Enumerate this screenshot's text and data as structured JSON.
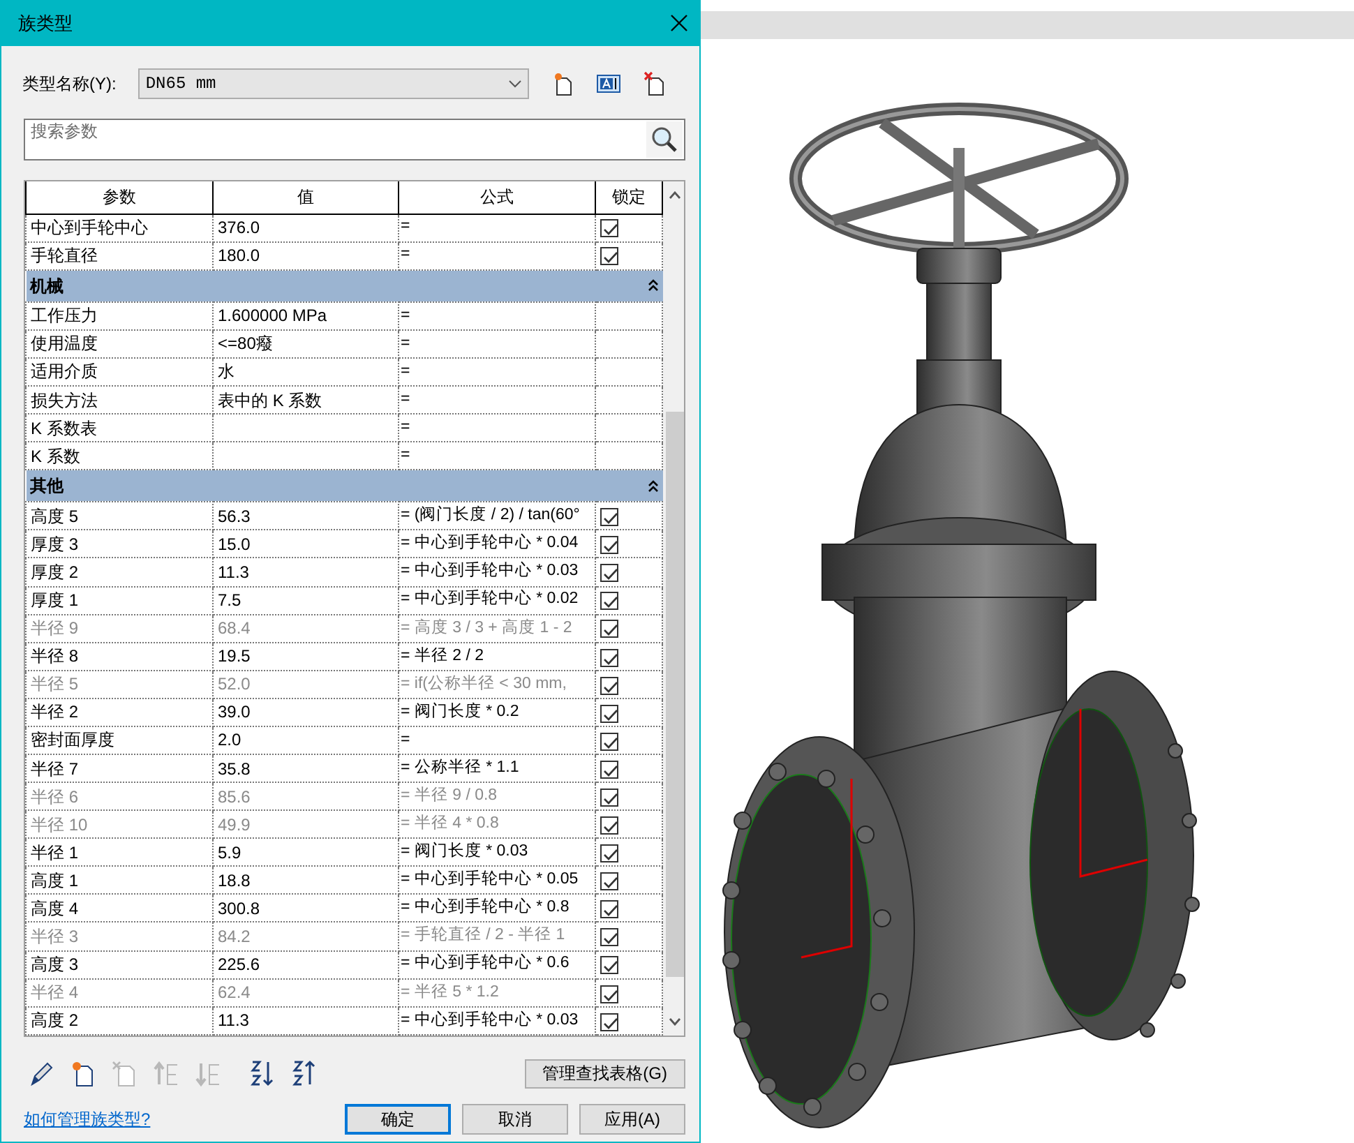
{
  "window": {
    "title": "族类型"
  },
  "type_name": {
    "label": "类型名称(Y):",
    "value": "DN65 mm"
  },
  "search": {
    "placeholder": "搜索参数"
  },
  "table": {
    "columns": [
      "参数",
      "值",
      "公式",
      "锁定"
    ],
    "sections": [
      {
        "rows": [
          {
            "name": "中心到手轮中心",
            "value": "376.0",
            "formula": "=",
            "locked": true,
            "disabled": false
          },
          {
            "name": "手轮直径",
            "value": "180.0",
            "formula": "=",
            "locked": true,
            "disabled": false
          }
        ]
      },
      {
        "title": "机械",
        "expanded": true,
        "rows": [
          {
            "name": "工作压力",
            "value": "1.600000 MPa",
            "formula": "=",
            "disabled": false
          },
          {
            "name": "使用温度",
            "value": "<=80癈",
            "formula": "=",
            "disabled": false
          },
          {
            "name": "适用介质",
            "value": "水",
            "formula": "=",
            "disabled": false
          },
          {
            "name": "损失方法",
            "value": "表中的 K 系数",
            "formula": "=",
            "disabled": false
          },
          {
            "name": "K 系数表",
            "value": "",
            "formula": "=",
            "disabled": false
          },
          {
            "name": "K 系数",
            "value": "",
            "formula": "=",
            "disabled": false
          }
        ]
      },
      {
        "title": "其他",
        "expanded": true,
        "rows": [
          {
            "name": "高度 5",
            "value": "56.3",
            "formula": "= (阀门长度 / 2) / tan(60°",
            "locked": true,
            "disabled": false
          },
          {
            "name": "厚度 3",
            "value": "15.0",
            "formula": "= 中心到手轮中心 * 0.04",
            "locked": true,
            "disabled": false
          },
          {
            "name": "厚度 2",
            "value": "11.3",
            "formula": "= 中心到手轮中心 * 0.03",
            "locked": true,
            "disabled": false
          },
          {
            "name": "厚度 1",
            "value": "7.5",
            "formula": "= 中心到手轮中心 * 0.02",
            "locked": true,
            "disabled": false
          },
          {
            "name": "半径 9",
            "value": "68.4",
            "formula": "= 高度 3 / 3 + 高度 1 - 2",
            "locked": true,
            "disabled": true
          },
          {
            "name": "半径 8",
            "value": "19.5",
            "formula": "= 半径 2 / 2",
            "locked": true,
            "disabled": false
          },
          {
            "name": "半径 5",
            "value": "52.0",
            "formula": "= if(公称半径 < 30 mm,",
            "locked": true,
            "disabled": true
          },
          {
            "name": "半径 2",
            "value": "39.0",
            "formula": "= 阀门长度 * 0.2",
            "locked": true,
            "disabled": false
          },
          {
            "name": "密封面厚度",
            "value": "2.0",
            "formula": "=",
            "locked": true,
            "disabled": false
          },
          {
            "name": "半径 7",
            "value": "35.8",
            "formula": "= 公称半径 * 1.1",
            "locked": true,
            "disabled": false
          },
          {
            "name": "半径 6",
            "value": "85.6",
            "formula": "= 半径 9 / 0.8",
            "locked": true,
            "disabled": true
          },
          {
            "name": "半径 10",
            "value": "49.9",
            "formula": "= 半径 4 * 0.8",
            "locked": true,
            "disabled": true
          },
          {
            "name": "半径 1",
            "value": "5.9",
            "formula": "= 阀门长度 * 0.03",
            "locked": true,
            "disabled": false
          },
          {
            "name": "高度 1",
            "value": "18.8",
            "formula": "= 中心到手轮中心 * 0.05",
            "locked": true,
            "disabled": false
          },
          {
            "name": "高度 4",
            "value": "300.8",
            "formula": "= 中心到手轮中心 * 0.8",
            "locked": true,
            "disabled": false
          },
          {
            "name": "半径 3",
            "value": "84.2",
            "formula": "= 手轮直径 / 2 - 半径 1",
            "locked": true,
            "disabled": true
          },
          {
            "name": "高度 3",
            "value": "225.6",
            "formula": "= 中心到手轮中心 * 0.6",
            "locked": true,
            "disabled": false
          },
          {
            "name": "半径 4",
            "value": "62.4",
            "formula": "= 半径 5 * 1.2",
            "locked": true,
            "disabled": true
          },
          {
            "name": "高度 2",
            "value": "11.3",
            "formula": "= 中心到手轮中心 * 0.03",
            "locked": true,
            "disabled": false
          }
        ]
      }
    ]
  },
  "tools": [
    {
      "kind": "edit",
      "disabled": false
    },
    {
      "kind": "new",
      "disabled": false
    },
    {
      "kind": "delete",
      "disabled": true
    },
    {
      "kind": "up",
      "disabled": true
    },
    {
      "kind": "down",
      "disabled": true
    },
    {
      "kind": "sort_asc",
      "disabled": false
    },
    {
      "kind": "sort_desc",
      "disabled": false
    }
  ],
  "lookup_button": "管理查找表格(G)",
  "help_link": "如何管理族类型?",
  "buttons": [
    {
      "label": "确定",
      "default": true
    },
    {
      "label": "取消",
      "default": false
    },
    {
      "label": "应用(A)",
      "default": false
    }
  ]
}
